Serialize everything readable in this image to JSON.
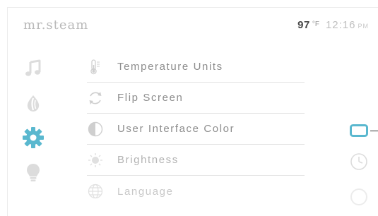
{
  "header": {
    "logo_text": "mr.steam",
    "temperature_value": "97",
    "temperature_unit": "°F",
    "time": "12:16",
    "ampm": "PM"
  },
  "side_nav": {
    "items": [
      {
        "icon": "music-note-icon",
        "state": "inactive"
      },
      {
        "icon": "aroma-drop-icon",
        "state": "inactive"
      },
      {
        "icon": "gear-icon",
        "state": "active"
      },
      {
        "icon": "lightbulb-icon",
        "state": "inactive"
      }
    ]
  },
  "settings_menu": {
    "items": [
      {
        "label": "Temperature Units",
        "icon": "thermometer-icon"
      },
      {
        "label": "Flip Screen",
        "icon": "rotate-arrows-icon"
      },
      {
        "label": "User Interface Color",
        "icon": "half-circle-contrast-icon"
      },
      {
        "label": "Brightness",
        "icon": "sun-icon"
      },
      {
        "label": "Language",
        "icon": "globe-icon"
      }
    ]
  },
  "right_rail": {
    "items": [
      {
        "icon": "screen-frame-icon",
        "state": "active"
      },
      {
        "icon": "clock-icon",
        "state": "inactive"
      },
      {
        "icon": "circle-icon",
        "state": "inactive"
      }
    ]
  },
  "colors": {
    "accent": "#5ab8cf",
    "icon_inactive": "#dcdcdc",
    "text_primary": "#8d8d8d",
    "divider": "#e3e3e3"
  }
}
